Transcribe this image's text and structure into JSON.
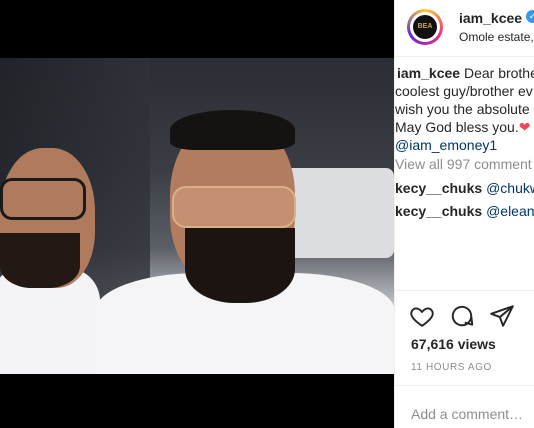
{
  "post": {
    "username": "iam_kcee",
    "location": "Omole estate,",
    "avatar_text": "BEA"
  },
  "caption": {
    "username": "iam_kcee",
    "line1": "Dear brothe",
    "line2": "coolest guy/brother ev",
    "line3": "wish you the absolute",
    "line4": "May God bless you.",
    "heart": "❤",
    "mention": "@iam_emoney1"
  },
  "comments": {
    "view_all": "View all 997 comment",
    "items": [
      {
        "username": "kecy__chuks",
        "text": "@chukw"
      },
      {
        "username": "kecy__chuks",
        "text": "@eleand"
      }
    ]
  },
  "stats": {
    "views": "67,616 views",
    "time": "11 HOURS AGO"
  },
  "add_comment": {
    "placeholder": "Add a comment…"
  },
  "icons": {
    "like": "heart-outline-icon",
    "comment": "comment-bubble-icon",
    "share": "paper-plane-icon",
    "verified": "verified-badge-icon"
  },
  "colors": {
    "verified": "#3897f0",
    "mention": "#003569",
    "muted": "#8e8e8e",
    "heart": "#ed4956"
  }
}
